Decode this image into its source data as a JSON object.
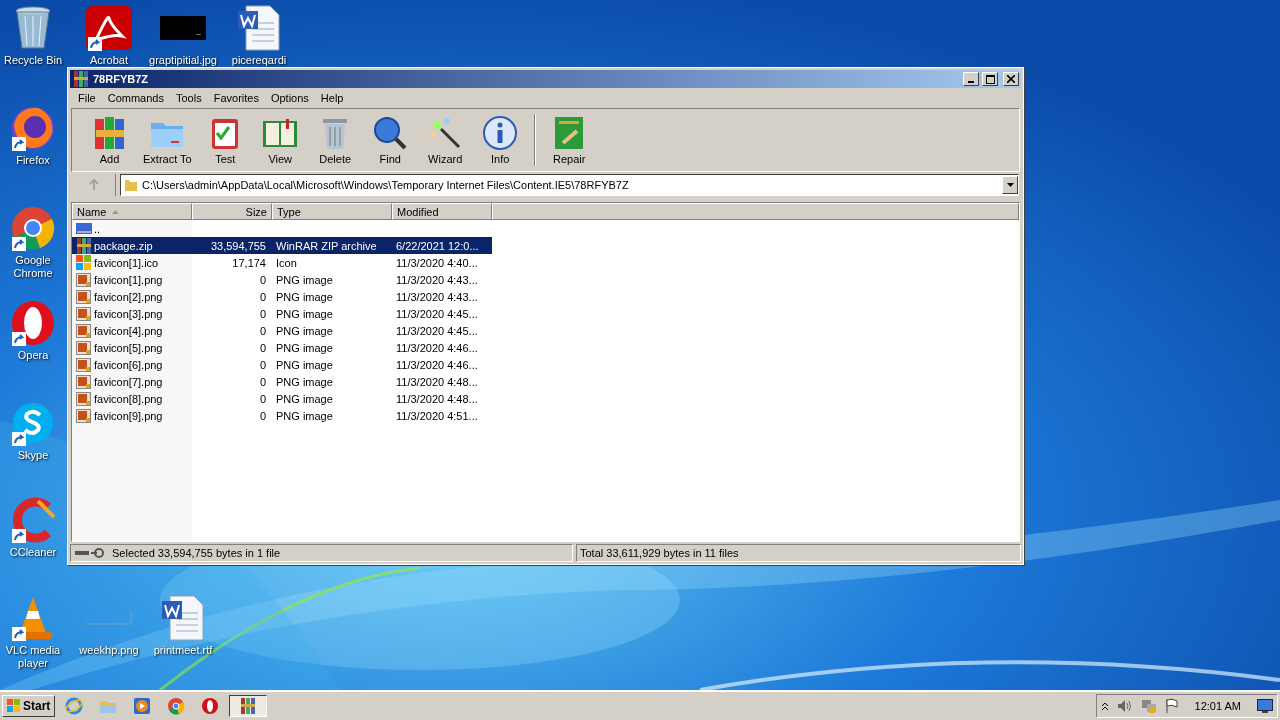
{
  "desktop_icons": [
    {
      "label": "Recycle Bin",
      "kind": "recycle",
      "shortcut": false
    },
    {
      "label": "Acrobat",
      "kind": "acrobat",
      "shortcut": true
    },
    {
      "label": "graptipitial.jpg",
      "kind": "dark-image",
      "shortcut": false
    },
    {
      "label": "picereqardi",
      "kind": "word",
      "shortcut": false
    },
    {
      "label": "Firefox",
      "kind": "firefox",
      "shortcut": true
    },
    {
      "label": "Google Chrome",
      "kind": "chrome",
      "shortcut": true
    },
    {
      "label": "Opera",
      "kind": "opera",
      "shortcut": true
    },
    {
      "label": "Skype",
      "kind": "skype",
      "shortcut": true
    },
    {
      "label": "CCleaner",
      "kind": "ccleaner",
      "shortcut": true
    },
    {
      "label": "VLC media player",
      "kind": "vlc",
      "shortcut": true
    },
    {
      "label": "weekhp.png",
      "kind": "blank-image",
      "shortcut": false
    },
    {
      "label": "printmeet.rtf",
      "kind": "word",
      "shortcut": false
    }
  ],
  "window": {
    "title": "78RFYB7Z",
    "menu": [
      "File",
      "Commands",
      "Tools",
      "Favorites",
      "Options",
      "Help"
    ],
    "toolbar": [
      {
        "label": "Add",
        "kind": "add"
      },
      {
        "label": "Extract To",
        "kind": "extract"
      },
      {
        "label": "Test",
        "kind": "test"
      },
      {
        "label": "View",
        "kind": "view"
      },
      {
        "label": "Delete",
        "kind": "delete"
      },
      {
        "label": "Find",
        "kind": "find"
      },
      {
        "label": "Wizard",
        "kind": "wizard"
      },
      {
        "label": "Info",
        "kind": "info"
      },
      {
        "label": "Repair",
        "kind": "repair"
      }
    ],
    "address": "C:\\Users\\admin\\AppData\\Local\\Microsoft\\Windows\\Temporary Internet Files\\Content.IE5\\78RFYB7Z",
    "columns": [
      {
        "label": "Name",
        "sorted": true
      },
      {
        "label": "Size",
        "sorted": false
      },
      {
        "label": "Type",
        "sorted": false
      },
      {
        "label": "Modified",
        "sorted": false
      }
    ],
    "rows": [
      {
        "name": "..",
        "kind": "up",
        "selected": false
      },
      {
        "name": "package.zip",
        "size": "33,594,755",
        "type": "WinRAR ZIP archive",
        "modified": "6/22/2021 12:0...",
        "kind": "zip",
        "selected": true
      },
      {
        "name": "favicon[1].ico",
        "size": "17,174",
        "type": "Icon",
        "modified": "11/3/2020 4:40...",
        "kind": "ico",
        "selected": false
      },
      {
        "name": "favicon[1].png",
        "size": "0",
        "type": "PNG image",
        "modified": "11/3/2020 4:43...",
        "kind": "png",
        "selected": false
      },
      {
        "name": "favicon[2].png",
        "size": "0",
        "type": "PNG image",
        "modified": "11/3/2020 4:43...",
        "kind": "png",
        "selected": false
      },
      {
        "name": "favicon[3].png",
        "size": "0",
        "type": "PNG image",
        "modified": "11/3/2020 4:45...",
        "kind": "png",
        "selected": false
      },
      {
        "name": "favicon[4].png",
        "size": "0",
        "type": "PNG image",
        "modified": "11/3/2020 4:45...",
        "kind": "png",
        "selected": false
      },
      {
        "name": "favicon[5].png",
        "size": "0",
        "type": "PNG image",
        "modified": "11/3/2020 4:46...",
        "kind": "png",
        "selected": false
      },
      {
        "name": "favicon[6].png",
        "size": "0",
        "type": "PNG image",
        "modified": "11/3/2020 4:46...",
        "kind": "png",
        "selected": false
      },
      {
        "name": "favicon[7].png",
        "size": "0",
        "type": "PNG image",
        "modified": "11/3/2020 4:48...",
        "kind": "png",
        "selected": false
      },
      {
        "name": "favicon[8].png",
        "size": "0",
        "type": "PNG image",
        "modified": "11/3/2020 4:48...",
        "kind": "png",
        "selected": false
      },
      {
        "name": "favicon[9].png",
        "size": "0",
        "type": "PNG image",
        "modified": "11/3/2020 4:51...",
        "kind": "png",
        "selected": false
      }
    ],
    "status_bar": {
      "selected": "Selected 33,594,755 bytes in 1 file",
      "total": "Total 33,611,929 bytes in 11 files"
    }
  },
  "taskbar": {
    "start": "Start",
    "buttons": [
      {
        "kind": "ie",
        "active": false
      },
      {
        "kind": "explorer",
        "active": false
      },
      {
        "kind": "media",
        "active": false
      },
      {
        "kind": "chrome",
        "active": false
      },
      {
        "kind": "opera",
        "active": false
      },
      {
        "kind": "winrar",
        "active": true
      }
    ],
    "clock": "12:01 AM"
  }
}
